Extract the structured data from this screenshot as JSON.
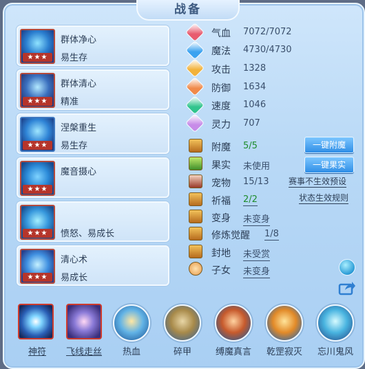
{
  "title": "战备",
  "skills": [
    {
      "name": "群体净心",
      "sub": "易生存",
      "stars": "★★★"
    },
    {
      "name": "群体清心",
      "sub": "精准",
      "stars": "★★★"
    },
    {
      "name": "涅槃重生",
      "sub": "易生存",
      "stars": "★★★"
    },
    {
      "name": "魔音摄心",
      "sub": "",
      "stars": "★★★"
    },
    {
      "name": "",
      "sub": "愤怒、易成长",
      "stars": "★★★"
    },
    {
      "name": "清心术",
      "sub": "易成长",
      "stars": "★★★"
    }
  ],
  "stats": [
    {
      "label": "气血",
      "value": "7072/7072",
      "color": "#e85b6f"
    },
    {
      "label": "魔法",
      "value": "4730/4730",
      "color": "#3aa2f0"
    },
    {
      "label": "攻击",
      "value": "1328",
      "color": "#f2b23a"
    },
    {
      "label": "防御",
      "value": "1634",
      "color": "#f08a4a"
    },
    {
      "label": "速度",
      "value": "1046",
      "color": "#31c48d"
    },
    {
      "label": "灵力",
      "value": "707",
      "color": "#c78be8"
    }
  ],
  "attrs": [
    {
      "label": "附魔",
      "value": "5/5"
    },
    {
      "label": "果实",
      "value": "未使用"
    },
    {
      "label": "宠物",
      "value": "15/13"
    },
    {
      "label": "祈福",
      "value": "2/2"
    },
    {
      "label": "变身",
      "value": "未变身"
    },
    {
      "label": "修炼觉醒",
      "value": "1/8"
    },
    {
      "label": "封地",
      "value": "未受赏"
    },
    {
      "label": "子女",
      "value": "未变身"
    }
  ],
  "buttons": {
    "enchant": "一键附魔",
    "fruit": "一键果实"
  },
  "links": {
    "season": "赛事不生效预设",
    "status_rules": "状态生效规则"
  },
  "talismans": [
    {
      "label": "神符",
      "icon": "talisman-star-icon"
    },
    {
      "label": "飞线走丝",
      "icon": "talisman-swirl-icon"
    },
    {
      "label": "热血",
      "icon": "talisman-flame-icon"
    },
    {
      "label": "碎甲",
      "icon": "talisman-shield-icon"
    },
    {
      "label": "缚魔真言",
      "icon": "talisman-beast-icon"
    },
    {
      "label": "乾罡寂灭",
      "icon": "talisman-warrior-icon"
    },
    {
      "label": "忘川鬼风",
      "icon": "talisman-wind-icon"
    }
  ]
}
